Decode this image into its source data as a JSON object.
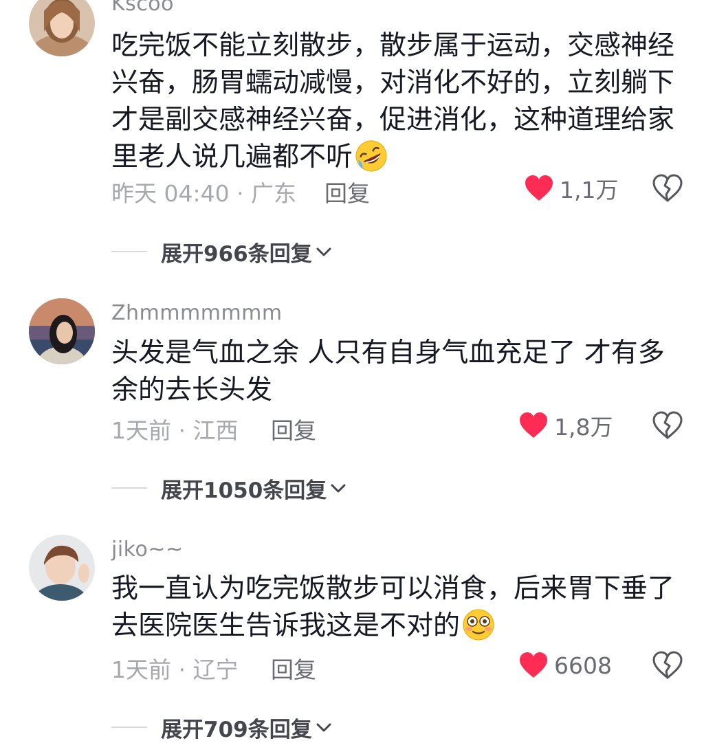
{
  "comments": [
    {
      "username": "Kscoo",
      "text": "吃完饭不能立刻散步，散步属于运动，交感神经兴奋，肠胃蠕动减慢，对消化不好的，立刻躺下才是副交感神经兴奋，促进消化，这种道理给家里老人说几遍都不听",
      "emoji": "rolling-on-floor-laughing-emoji",
      "meta": "昨天 04:40 · 广东",
      "reply_label": "回复",
      "likes": "1,1万",
      "expand_label": "展开966条回复"
    },
    {
      "username": "Zhmmmmmmm",
      "text": "头发是气血之余 人只有自身气血充足了 才有多余的去长头发",
      "meta": "1天前 · 江西",
      "reply_label": "回复",
      "likes": "1,8万",
      "expand_label": "展开1050条回复"
    },
    {
      "username": "jiko~~",
      "text": "我一直认为吃完饭散步可以消食，后来胃下垂了去医院医生告诉我这是不对的",
      "emoji": "flushed-face-emoji",
      "meta": "1天前 · 辽宁",
      "reply_label": "回复",
      "likes": "6608",
      "expand_label": "展开709条回复"
    }
  ],
  "colors": {
    "like_heart": "#fe2c55",
    "secondary_text": "#a7a8ad",
    "primary_text": "#161823"
  },
  "icons": {
    "like": "heart-filled-icon",
    "dislike": "broken-heart-icon",
    "expand": "chevron-down-icon"
  }
}
